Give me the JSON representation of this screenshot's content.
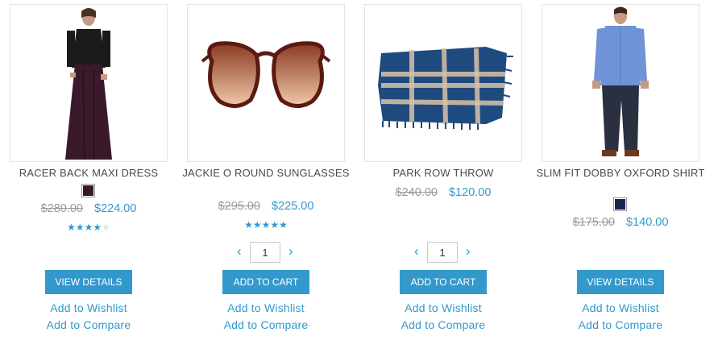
{
  "products": [
    {
      "name": "RACER BACK MAXI DRESS",
      "image": "woman-in-maxi-dress-photo",
      "swatch_color": "#3a1a22",
      "old_price": "$280.00",
      "special_price": "$224.00",
      "rating": 4,
      "rating_max": 5,
      "button_label": "VIEW DETAILS",
      "wishlist_label": "Add to Wishlist",
      "compare_label": "Add to Compare"
    },
    {
      "name": "JACKIE O ROUND SUNGLASSES",
      "image": "round-sunglasses-photo",
      "old_price": "$295.00",
      "special_price": "$225.00",
      "rating": 5,
      "rating_max": 5,
      "qty": "1",
      "button_label": "ADD TO CART",
      "wishlist_label": "Add to Wishlist",
      "compare_label": "Add to Compare"
    },
    {
      "name": "PARK ROW THROW",
      "image": "plaid-throw-blanket-photo",
      "old_price": "$240.00",
      "special_price": "$120.00",
      "qty": "1",
      "button_label": "ADD TO CART",
      "wishlist_label": "Add to Wishlist",
      "compare_label": "Add to Compare"
    },
    {
      "name": "SLIM FIT DOBBY OXFORD SHIRT",
      "image": "man-in-blue-shirt-photo",
      "swatch_color": "#1c2450",
      "old_price": "$175.00",
      "special_price": "$140.00",
      "button_label": "VIEW DETAILS",
      "wishlist_label": "Add to Wishlist",
      "compare_label": "Add to Compare"
    }
  ],
  "icons": {
    "qty_decrease": "chevron-left-icon",
    "qty_increase": "chevron-right-icon"
  },
  "colors": {
    "accent": "#3399cc",
    "old_price": "#9a9a9a",
    "name_text": "#4a4a4a",
    "border": "#e4e4e4"
  }
}
